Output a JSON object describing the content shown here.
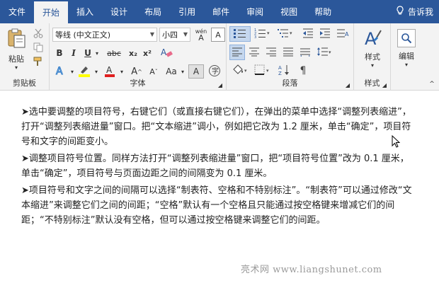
{
  "tabs": [
    {
      "label": "文件"
    },
    {
      "label": "开始"
    },
    {
      "label": "插入"
    },
    {
      "label": "设计"
    },
    {
      "label": "布局"
    },
    {
      "label": "引用"
    },
    {
      "label": "邮件"
    },
    {
      "label": "审阅"
    },
    {
      "label": "视图"
    },
    {
      "label": "帮助"
    }
  ],
  "tellme": {
    "label": "告诉我"
  },
  "clipboard": {
    "paste_label": "粘贴",
    "group_label": "剪贴板"
  },
  "font": {
    "name_value": "等线 (中文正文)",
    "size_value": "小四",
    "group_label": "字体",
    "bold": "B",
    "italic": "I",
    "underline": "U",
    "strike": "abc",
    "sub": "x₂",
    "sup": "x²",
    "grow": "A",
    "shrink": "A",
    "case": "Aa",
    "wen": "wén",
    "wen2": "A"
  },
  "paragraph": {
    "group_label": "段落"
  },
  "styles": {
    "label": "样式",
    "group_label": "样式"
  },
  "editing": {
    "label": "编辑"
  },
  "document": {
    "paragraphs": [
      "➤选中要调整的项目符号，右键它们（或直接右键它们），在弹出的菜单中选择“调整列表缩进”，打开“调整列表缩进量”窗口。把“文本缩进”调小，例如把它改为 1.2 厘米，单击“确定”，项目符号和文字的间距变小。",
      "➤调整项目符号位置。同样方法打开“调整列表缩进量”窗口，把“项目符号位置”改为 0.1 厘米，单击“确定”，项目符号与页面边距之间的间隔变为 0.1 厘米。",
      "➤项目符号和文字之间的间隔可以选择“制表符、空格和不特别标注”。“制表符”可以通过修改“文本缩进”来调整它们之间的间距；“空格”默认有一个空格且只能通过按空格键来增减它们的间距；“不特别标注”默认没有空格，但可以通过按空格键来调整它们的间距。"
    ]
  },
  "watermark": "亮术网 www.liangshunet.com",
  "colors": {
    "accent": "#2b579a",
    "highlight": "#ffff00",
    "font_red": "#e02020"
  }
}
